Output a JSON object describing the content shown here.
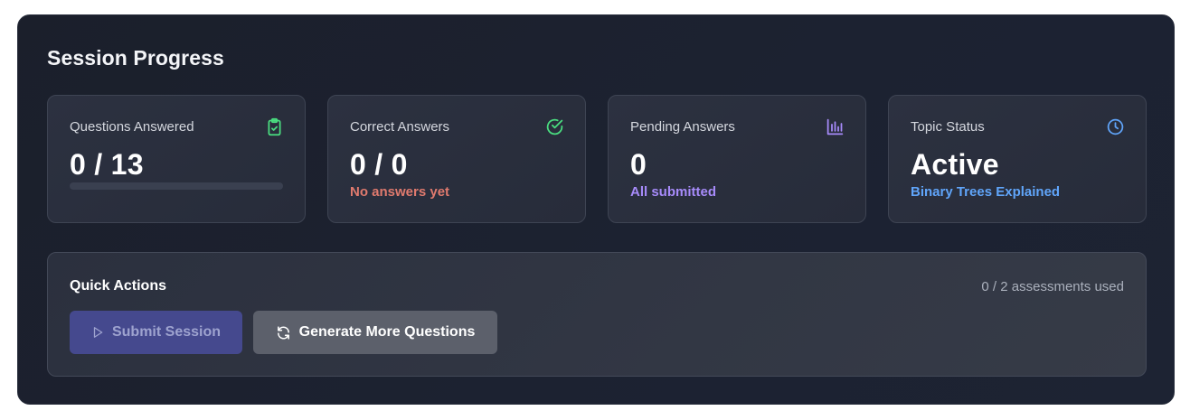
{
  "session": {
    "title": "Session Progress",
    "cards": [
      {
        "label": "Questions Answered",
        "value": "0 / 13",
        "progress_fraction": 0,
        "icon": "clipboard-check-icon",
        "accent": "#4ade80"
      },
      {
        "label": "Correct Answers",
        "value": "0 / 0",
        "sub": "No answers yet",
        "sub_color": "#e07a6e",
        "icon": "check-circle-icon",
        "accent": "#4ade80"
      },
      {
        "label": "Pending Answers",
        "value": "0",
        "sub": "All submitted",
        "sub_color": "#a78bfa",
        "icon": "bar-chart-icon",
        "accent": "#a78bfa"
      },
      {
        "label": "Topic Status",
        "value": "Active",
        "sub": "Binary Trees Explained",
        "sub_color": "#60a5fa",
        "icon": "clock-icon",
        "accent": "#60a5fa"
      }
    ]
  },
  "quick_actions": {
    "title": "Quick Actions",
    "usage": "0 / 2 assessments used",
    "submit_label": "Submit Session",
    "generate_label": "Generate More Questions"
  }
}
